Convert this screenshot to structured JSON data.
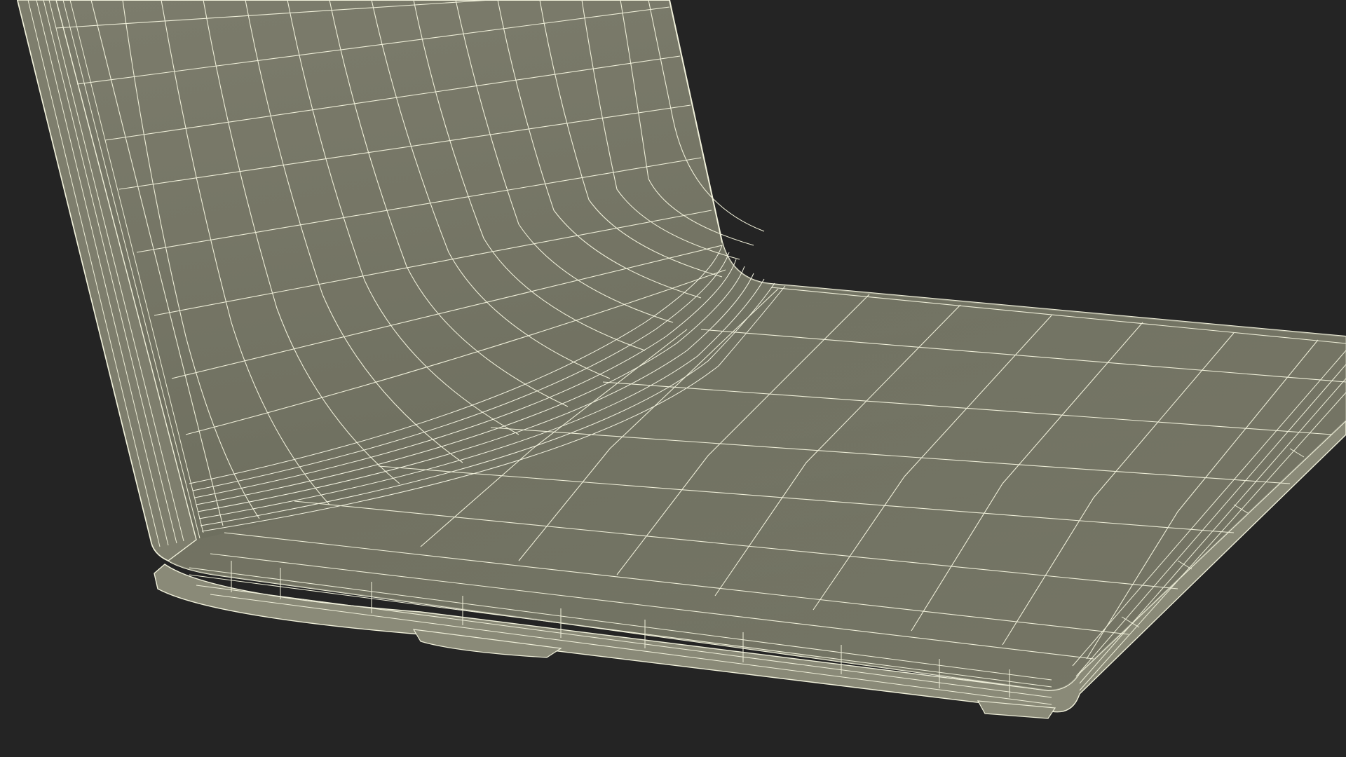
{
  "scene": {
    "subject": "laptop-wireframe-render",
    "colors": {
      "background": "#242424",
      "surface_light": "#7a7a6b",
      "surface_dark": "#6b6c5c",
      "edge_band": "#8a8a78",
      "wire": "#eeeed8",
      "wire_dense": "#f4f4e2"
    }
  }
}
